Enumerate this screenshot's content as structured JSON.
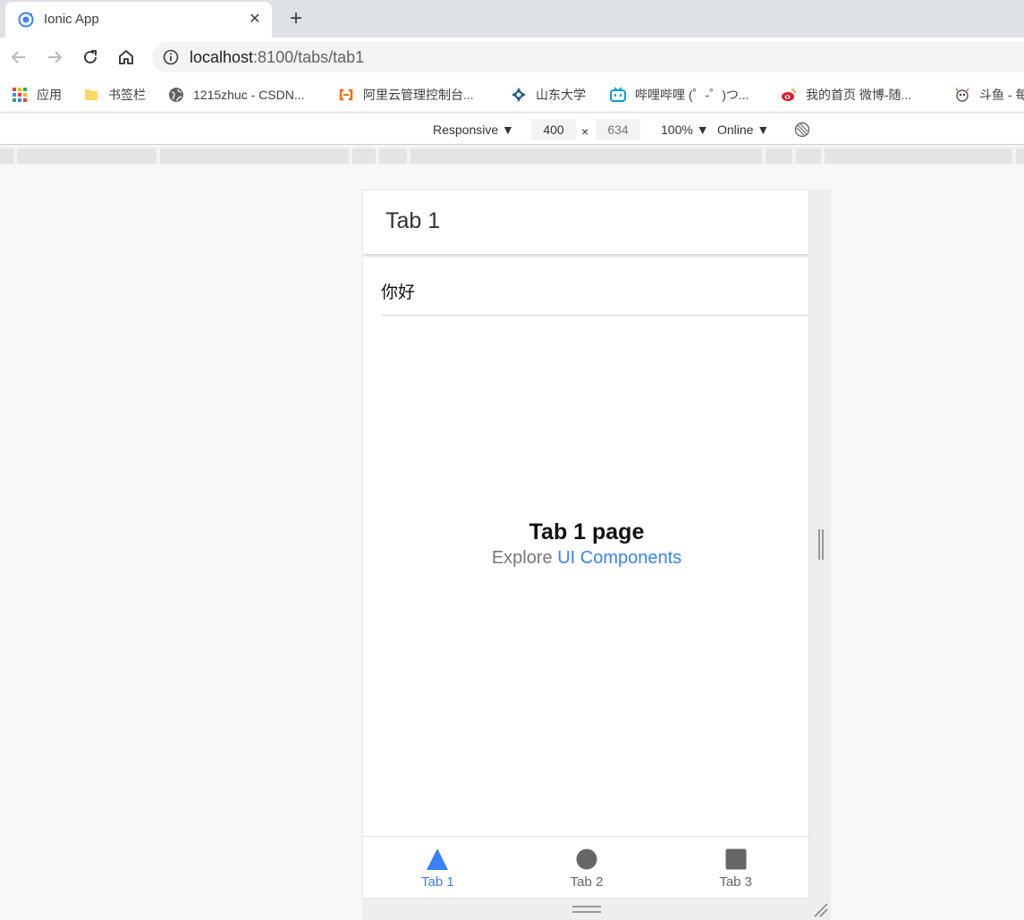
{
  "browser": {
    "tab": {
      "title": "Ionic App",
      "close_glyph": "✕"
    },
    "new_tab_glyph": "+",
    "url": {
      "host": "localhost",
      "rest": ":8100/tabs/tab1"
    },
    "bookmarks": [
      {
        "label": "应用",
        "icon": "apps-grid-icon"
      },
      {
        "label": "书签栏",
        "icon": "folder-icon"
      },
      {
        "label": "1215zhuc - CSDN...",
        "icon": "globe-icon"
      },
      {
        "label": "阿里云管理控制台...",
        "icon": "aliyun-icon"
      },
      {
        "label": "山东大学",
        "icon": "sdu-logo-icon"
      },
      {
        "label": "哔哩哔哩 (゜-゜)つ...",
        "icon": "bilibili-icon"
      },
      {
        "label": "我的首页 微博-随...",
        "icon": "weibo-icon"
      },
      {
        "label": "斗鱼 - 每",
        "icon": "douyu-icon"
      }
    ]
  },
  "devtools": {
    "device": "Responsive ▼",
    "width": "400",
    "times": "×",
    "height": "634",
    "zoom": "100% ▼",
    "throttle": "Online ▼"
  },
  "app": {
    "header_title": "Tab 1",
    "item_label": "你好",
    "container": {
      "title": "Tab 1 page",
      "explore": "Explore ",
      "link": "UI Components"
    },
    "tabs": [
      {
        "label": "Tab 1",
        "icon": "triangle-icon",
        "active": true
      },
      {
        "label": "Tab 2",
        "icon": "ellipse-icon",
        "active": false
      },
      {
        "label": "Tab 3",
        "icon": "square-icon",
        "active": false
      }
    ],
    "colors": {
      "primary": "#3880ff",
      "inactive": "#666666"
    }
  }
}
